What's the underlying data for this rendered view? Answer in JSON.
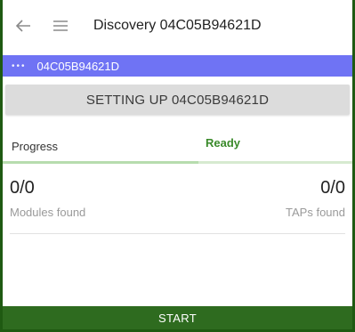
{
  "header": {
    "back_icon": "arrow-left-icon",
    "menu_icon": "hamburger-menu-icon",
    "title": "Discovery 04C05B94621D"
  },
  "device_bar": {
    "dots_icon": "more-horizontal-icon",
    "label": "04C05B94621D",
    "color": "#6f73f4"
  },
  "setup": {
    "banner": "SETTING UP 04C05B94621D"
  },
  "status": {
    "progress_label": "Progress",
    "state_label": "Ready",
    "progress_fraction": 0.56,
    "accent_color": "#3a8a2a"
  },
  "stats": {
    "modules": {
      "value": "0/0",
      "caption": "Modules found"
    },
    "taps": {
      "value": "0/0",
      "caption": "TAPs found"
    }
  },
  "footer": {
    "start_label": "START",
    "color": "#2e6b1f"
  }
}
